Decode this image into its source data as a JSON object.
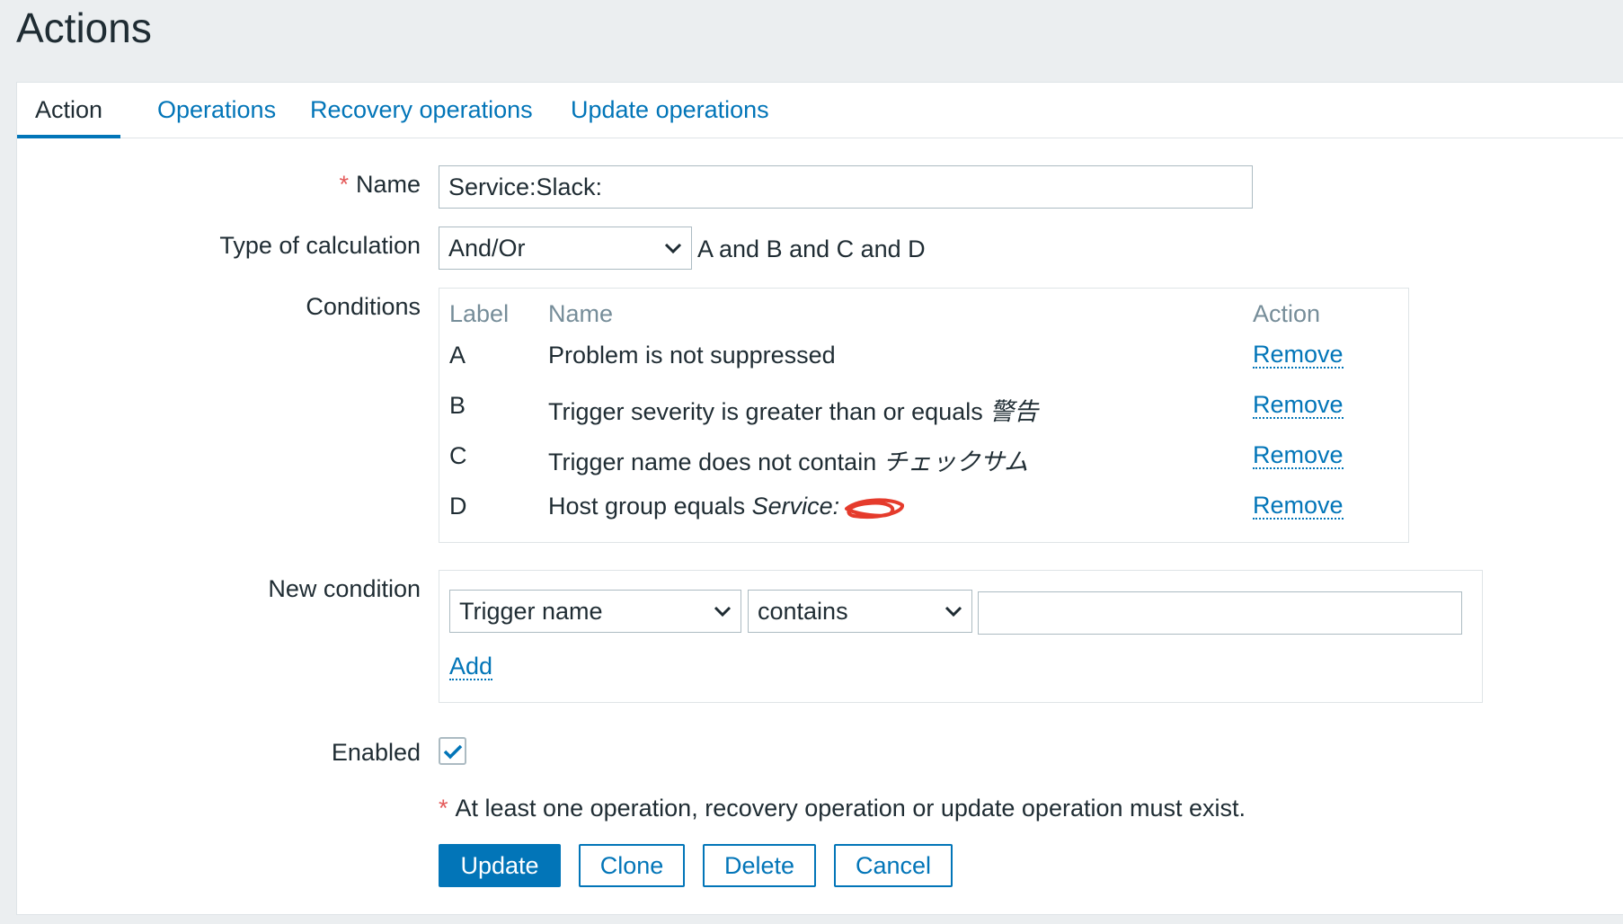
{
  "page": {
    "title": "Actions"
  },
  "tabs": [
    {
      "label": "Action",
      "active": true
    },
    {
      "label": "Operations",
      "active": false
    },
    {
      "label": "Recovery operations",
      "active": false
    },
    {
      "label": "Update operations",
      "active": false
    }
  ],
  "form": {
    "name_label": "Name",
    "required_mark": "*",
    "name_value": "Service:Slack:",
    "calc_label": "Type of calculation",
    "calc_value": "And/Or",
    "calc_formula": "A and B and C and D",
    "conditions_label": "Conditions",
    "conditions_headers": {
      "label": "Label",
      "name": "Name",
      "action": "Action"
    },
    "conditions": [
      {
        "label": "A",
        "text": "Problem is not suppressed",
        "value": "",
        "action": "Remove"
      },
      {
        "label": "B",
        "text": "Trigger severity is greater than or equals ",
        "value": "警告",
        "action": "Remove"
      },
      {
        "label": "C",
        "text": "Trigger name does not contain ",
        "value": "チェックサム",
        "action": "Remove"
      },
      {
        "label": "D",
        "text": "Host group equals ",
        "value": "Service:",
        "action": "Remove"
      }
    ],
    "new_condition_label": "New condition",
    "new_condition_type": "Trigger name",
    "new_condition_operator": "contains",
    "new_condition_value": "",
    "add_label": "Add",
    "enabled_label": "Enabled",
    "enabled": true,
    "operation_note": "At least one operation, recovery operation or update operation must exist."
  },
  "buttons": {
    "update": "Update",
    "clone": "Clone",
    "delete": "Delete",
    "cancel": "Cancel"
  },
  "colors": {
    "accent": "#0275b8",
    "required": "#e45959",
    "redaction": "#e53b2c"
  },
  "icons": {
    "dropdown": "chevron-down-icon",
    "checkbox": "check-icon"
  }
}
